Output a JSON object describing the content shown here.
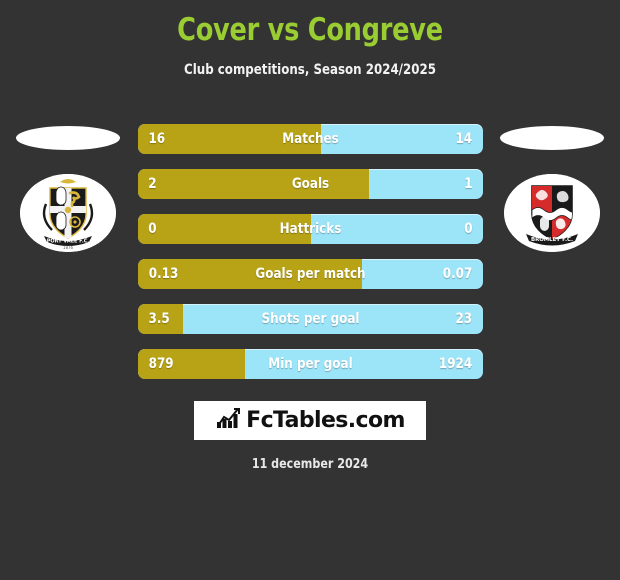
{
  "header": {
    "title": "Cover vs Congreve",
    "subtitle": "Club competitions, Season 2024/2025",
    "title_color": "#9ACD32"
  },
  "teams": {
    "home": {
      "badge_name": "port-vale-fc-badge",
      "badge_text": "PORT VALE F.C.",
      "badge_year": "1876"
    },
    "away": {
      "badge_name": "bromley-fc-badge",
      "badge_text": "BROMLEY F.C."
    }
  },
  "colors": {
    "background": "#333333",
    "home_bar": "#B8A317",
    "away_bar": "#9CE4F8",
    "title": "#9ACD32"
  },
  "chart_data": {
    "type": "bar",
    "title": "Cover vs Congreve",
    "subtitle": "Club competitions, Season 2024/2025",
    "xlabel": "",
    "ylabel": "",
    "legend_position": "none",
    "grid": false,
    "orientation": "horizontal-diverging",
    "categories": [
      "Matches",
      "Goals",
      "Hattricks",
      "Goals per match",
      "Shots per goal",
      "Min per goal"
    ],
    "series": [
      {
        "name": "Cover",
        "values": [
          "16",
          "2",
          "0",
          "0.13",
          "3.5",
          "879"
        ]
      },
      {
        "name": "Congreve",
        "values": [
          "14",
          "1",
          "0",
          "0.07",
          "23",
          "1924"
        ]
      }
    ],
    "rows": [
      {
        "label": "Matches",
        "home": "16",
        "away": "14",
        "home_pct": 53
      },
      {
        "label": "Goals",
        "home": "2",
        "away": "1",
        "home_pct": 67
      },
      {
        "label": "Hattricks",
        "home": "0",
        "away": "0",
        "home_pct": 50
      },
      {
        "label": "Goals per match",
        "home": "0.13",
        "away": "0.07",
        "home_pct": 65
      },
      {
        "label": "Shots per goal",
        "home": "3.5",
        "away": "23",
        "home_pct": 13
      },
      {
        "label": "Min per goal",
        "home": "879",
        "away": "1924",
        "home_pct": 31
      }
    ]
  },
  "footer": {
    "logo_text": "FcTables.com",
    "logo_icon": "bar-chart-growth-icon",
    "date": "11 december 2024"
  }
}
